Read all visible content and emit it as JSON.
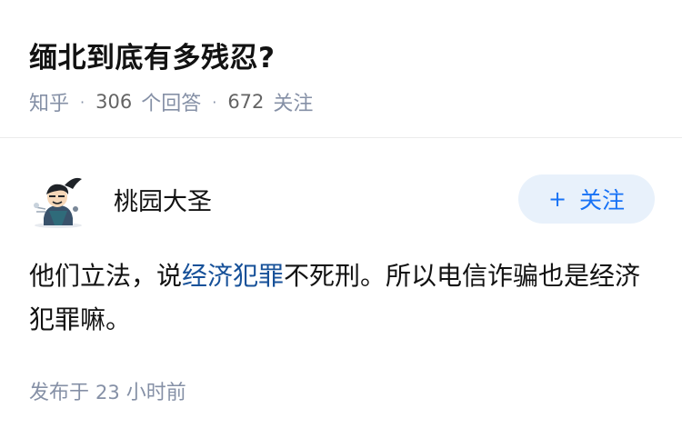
{
  "question": {
    "title": "缅北到底有多残忍?",
    "source": "知乎",
    "answer_count": "306",
    "answer_label": "个回答",
    "follower_count": "672",
    "follower_label": "关注",
    "separator": "·"
  },
  "answer": {
    "author": {
      "name": "桃园大圣",
      "avatar_icon": "cartoon-avatar-icon"
    },
    "follow_button": {
      "icon": "+",
      "label": "关注"
    },
    "content": {
      "before_link": "他们立法，说",
      "link_text": "经济犯罪",
      "after_link": "不死刑。所以电信诈骗也是经济犯罪嘛。"
    },
    "time": {
      "prefix": "发布于",
      "num": "23",
      "suffix": "小时前"
    }
  },
  "colors": {
    "link": "#175199",
    "follow_bg": "#e8f1fb",
    "follow_text": "#1772f6",
    "meta": "#8590a6"
  }
}
